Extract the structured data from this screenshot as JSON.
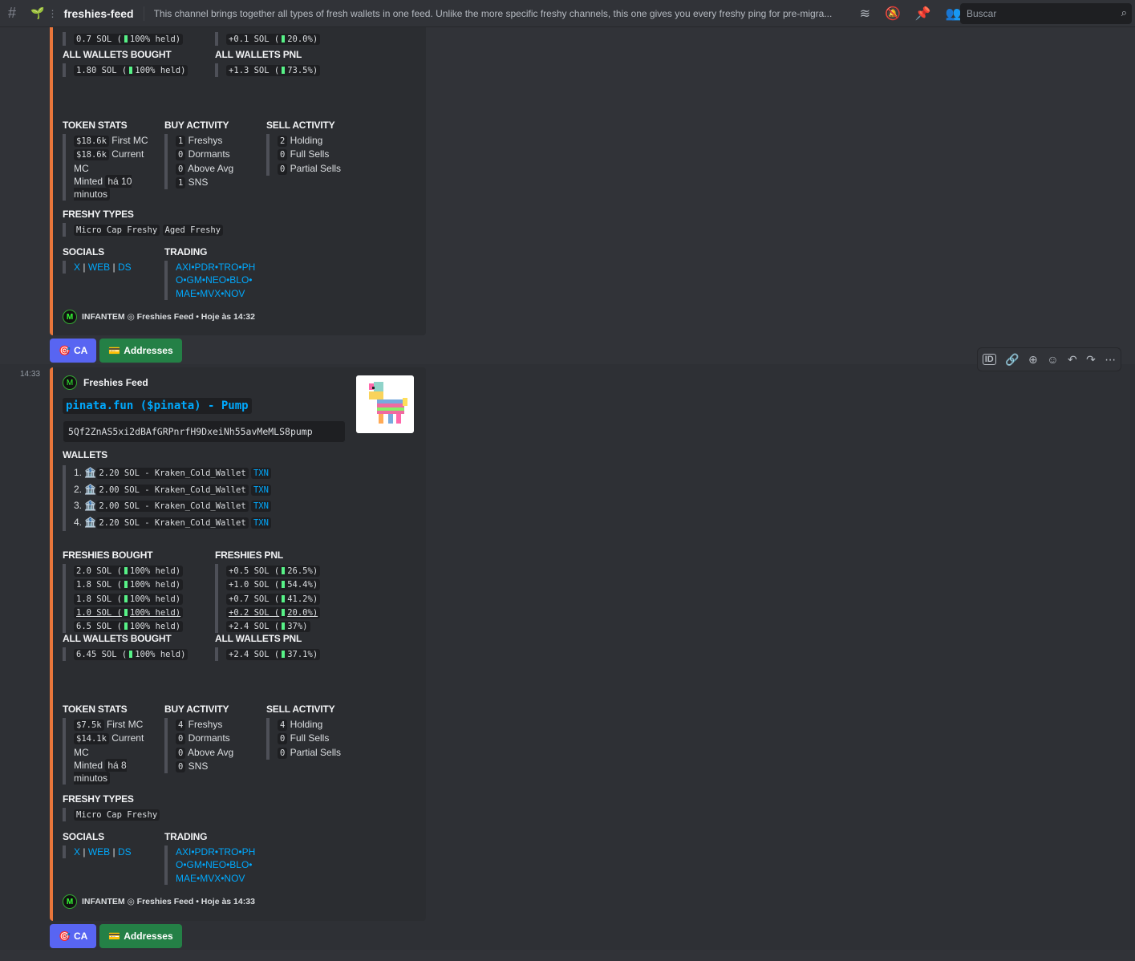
{
  "topbar": {
    "channel": "freshies-feed",
    "topic": "This channel brings together all types of fresh wallets in one feed. Unlike the more specific freshy channels, this one gives you every freshy ping for pre-migra...",
    "search_placeholder": "Buscar"
  },
  "msg1": {
    "top_rows": {
      "freshies_bought_last": "0.7  SOL  (",
      "freshies_bought_last_pct": "100% held)",
      "freshies_pnl_last": "+0.1  SOL  (",
      "freshies_pnl_last_pct": "20.0%)"
    },
    "all_wallets_bought_head": "ALL WALLETS BOUGHT",
    "all_wallets_bought": "1.80  SOL  (",
    "all_wallets_bought_pct": "100%  held)",
    "all_wallets_pnl_head": "ALL WALLETS PNL",
    "all_wallets_pnl": "+1.3  SOL  (",
    "all_wallets_pnl_pct": "73.5%)",
    "token_stats_head": "TOKEN STATS",
    "first_mc": "$18.6k",
    "first_mc_label": " First MC",
    "current_mc": "$18.6k",
    "current_mc_label": " Current MC",
    "minted_label": "Minted ",
    "minted": "há 10 minutos",
    "buy_head": "BUY ACTIVITY",
    "buy": [
      "1",
      " Freshys",
      "0",
      " Dormants",
      "0",
      " Above Avg",
      "1",
      " SNS"
    ],
    "sell_head": "SELL ACTIVITY",
    "sell": [
      "2",
      " Holding",
      "0",
      " Full Sells",
      "0",
      " Partial Sells"
    ],
    "freshy_types_head": "FRESHY TYPES",
    "freshy_types": [
      "Micro Cap Freshy",
      "Aged Freshy"
    ],
    "socials_head": "SOCIALS",
    "socials": [
      "X",
      "WEB",
      "DS"
    ],
    "trading_head": "TRADING",
    "trading": [
      "AXI•PDR•TRO•PH",
      "O•GM•NEO•BLO•",
      "MAE•MVX•NOV"
    ],
    "footer": "INFANTEM ◎ Freshies Feed • Hoje às 14:32",
    "btn_ca": "CA",
    "btn_addresses": "Addresses"
  },
  "msg2": {
    "time": "14:33",
    "author": "Freshies Feed",
    "title": "pinata.fun ($pinata) - Pump",
    "ca": "5Qf2ZnAS5xi2dBAfGRPnrfH9DxeiNh55avMeMLS8pump",
    "wallets_head": "WALLETS",
    "wallets": [
      {
        "n": "1.",
        "amt": "2.20  SOL  -  Kraken_Cold_Wallet",
        "txn": "TXN"
      },
      {
        "n": "2.",
        "amt": "2.00  SOL  -  Kraken_Cold_Wallet",
        "txn": "TXN"
      },
      {
        "n": "3.",
        "amt": "2.00  SOL  -  Kraken_Cold_Wallet",
        "txn": "TXN"
      },
      {
        "n": "4.",
        "amt": "2.20  SOL  -  Kraken_Cold_Wallet",
        "txn": "TXN"
      }
    ],
    "freshies_bought_head": "FRESHIES BOUGHT",
    "freshies_bought": [
      [
        "2.0  SOL  (",
        "100%  held)"
      ],
      [
        "1.8  SOL  (",
        "100%  held)"
      ],
      [
        "1.8  SOL  (",
        "100%  held)"
      ],
      [
        "1.0  SOL  (",
        "100%  held)"
      ],
      [
        "6.5  SOL  (",
        "100%  held)"
      ]
    ],
    "freshies_pnl_head": "FRESHIES PNL",
    "freshies_pnl": [
      [
        "+0.5  SOL  (",
        "26.5%)"
      ],
      [
        "+1.0  SOL  (",
        "54.4%)"
      ],
      [
        "+0.7  SOL  (",
        "41.2%)"
      ],
      [
        "+0.2  SOL  (",
        "20.0%)"
      ],
      [
        "+2.4  SOL  (",
        "37%)"
      ]
    ],
    "all_wallets_bought_head": "ALL WALLETS BOUGHT",
    "all_wallets_bought": "6.45  SOL  (",
    "all_wallets_bought_pct": "100%  held)",
    "all_wallets_pnl_head": "ALL WALLETS PNL",
    "all_wallets_pnl": "+2.4  SOL  (",
    "all_wallets_pnl_pct": "37.1%)",
    "token_stats_head": "TOKEN STATS",
    "first_mc": "$7.5k",
    "first_mc_label": " First MC",
    "current_mc": "$14.1k",
    "current_mc_label": " Current MC",
    "minted_label": "Minted ",
    "minted": "há 8 minutos",
    "buy_head": "BUY ACTIVITY",
    "buy": [
      "4",
      " Freshys",
      "0",
      " Dormants",
      "0",
      " Above Avg",
      "0",
      " SNS"
    ],
    "sell_head": "SELL ACTIVITY",
    "sell": [
      "4",
      " Holding",
      "0",
      " Full Sells",
      "0",
      " Partial Sells"
    ],
    "freshy_types_head": "FRESHY TYPES",
    "freshy_types": [
      "Micro Cap Freshy"
    ],
    "socials_head": "SOCIALS",
    "socials": [
      "X",
      "WEB",
      "DS"
    ],
    "trading_head": "TRADING",
    "trading": [
      "AXI•PDR•TRO•PH",
      "O•GM•NEO•BLO•",
      "MAE•MVX•NOV"
    ],
    "footer": "INFANTEM ◎ Freshies Feed • Hoje às 14:33",
    "btn_ca": "CA",
    "btn_addresses": "Addresses"
  },
  "colors": {
    "accent": "#e8763b",
    "blurple": "#5865f2",
    "green": "#248046",
    "link": "#00a8fc"
  }
}
